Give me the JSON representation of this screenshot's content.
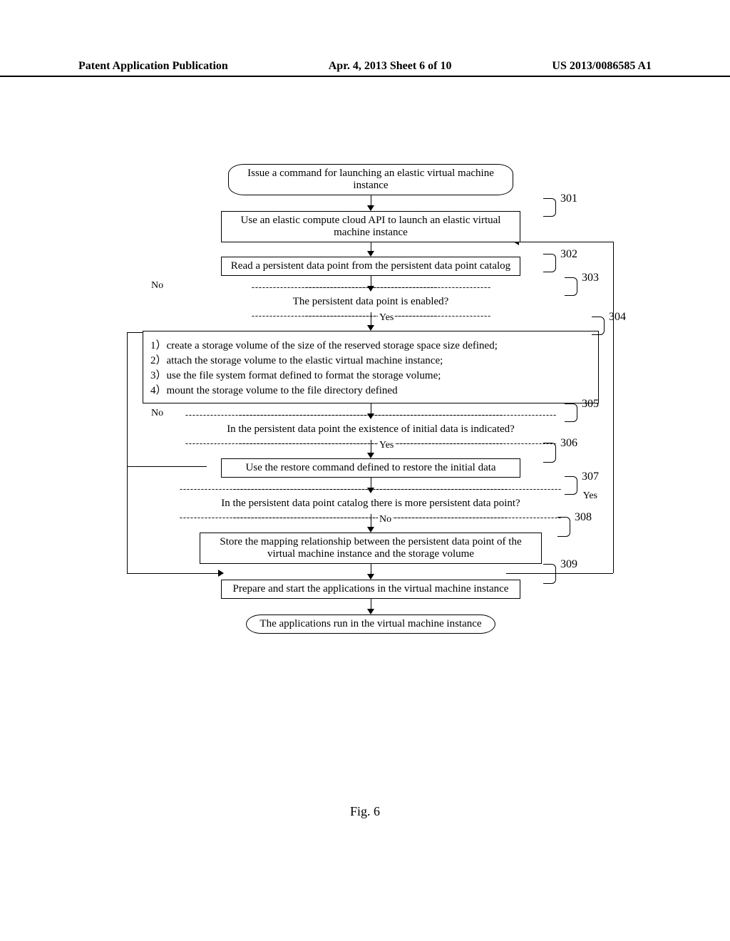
{
  "header": {
    "left": "Patent Application Publication",
    "center": "Apr. 4, 2013  Sheet 6 of 10",
    "right": "US 2013/0086585 A1"
  },
  "flow": {
    "start": "Issue a command for launching an elastic virtual machine instance",
    "s301": "Use an elastic compute cloud API to launch an elastic virtual machine instance",
    "s302": "Read a persistent data point from the persistent data point catalog",
    "d303": "The persistent data point is enabled?",
    "s304_1": "1）create a storage volume of the size of the reserved storage space size defined;",
    "s304_2": "2）attach the storage volume to the elastic virtual machine instance;",
    "s304_3": "3）use the file system format defined to format the storage volume;",
    "s304_4": "4）mount the storage volume to the file directory defined",
    "d305": "In the persistent data point the existence of initial data is indicated?",
    "s306": "Use the restore command defined to restore the initial data",
    "d307": "In the persistent data point catalog there is more persistent data point?",
    "s308": "Store the mapping relationship between the persistent data point of the virtual machine instance and the storage volume",
    "s309": "Prepare and start the applications in the virtual machine instance",
    "end": "The applications run in the virtual machine instance",
    "yes": "Yes",
    "no": "No"
  },
  "refs": {
    "r301": "301",
    "r302": "302",
    "r303": "303",
    "r304": "304",
    "r305": "305",
    "r306": "306",
    "r307": "307",
    "r308": "308",
    "r309": "309"
  },
  "caption": "Fig. 6",
  "chart_data": {
    "type": "flowchart",
    "title": "Fig. 6",
    "nodes": [
      {
        "id": "start",
        "kind": "terminator",
        "text": "Issue a command for launching an elastic virtual machine instance"
      },
      {
        "id": "301",
        "kind": "process",
        "text": "Use an elastic compute cloud API to launch an elastic virtual machine instance"
      },
      {
        "id": "302",
        "kind": "process",
        "text": "Read a persistent data point from the persistent data point catalog"
      },
      {
        "id": "303",
        "kind": "decision",
        "text": "The persistent data point is enabled?"
      },
      {
        "id": "304",
        "kind": "process",
        "text": "1) create a storage volume of the size of the reserved storage space size defined; 2) attach the storage volume to the elastic virtual machine instance; 3) use the file system format defined to format the storage volume; 4) mount the storage volume to the file directory defined"
      },
      {
        "id": "305",
        "kind": "decision",
        "text": "In the persistent data point the existence of initial data is indicated?"
      },
      {
        "id": "306",
        "kind": "process",
        "text": "Use the restore command defined to restore the initial data"
      },
      {
        "id": "307",
        "kind": "decision",
        "text": "In the persistent data point catalog there is more persistent data point?"
      },
      {
        "id": "308",
        "kind": "process",
        "text": "Store the mapping relationship between the persistent data point of the virtual machine instance and the storage volume"
      },
      {
        "id": "309",
        "kind": "process",
        "text": "Prepare and start the applications in the virtual machine instance"
      },
      {
        "id": "end",
        "kind": "terminator",
        "text": "The applications run in the virtual machine instance"
      }
    ],
    "edges": [
      {
        "from": "start",
        "to": "301"
      },
      {
        "from": "301",
        "to": "302"
      },
      {
        "from": "302",
        "to": "303"
      },
      {
        "from": "303",
        "to": "304",
        "label": "Yes"
      },
      {
        "from": "303",
        "to": "307",
        "label": "No"
      },
      {
        "from": "304",
        "to": "305"
      },
      {
        "from": "305",
        "to": "306",
        "label": "Yes"
      },
      {
        "from": "305",
        "to": "307",
        "label": "No"
      },
      {
        "from": "306",
        "to": "307"
      },
      {
        "from": "307",
        "to": "302",
        "label": "Yes"
      },
      {
        "from": "307",
        "to": "308",
        "label": "No"
      },
      {
        "from": "308",
        "to": "309"
      },
      {
        "from": "309",
        "to": "end"
      }
    ]
  }
}
